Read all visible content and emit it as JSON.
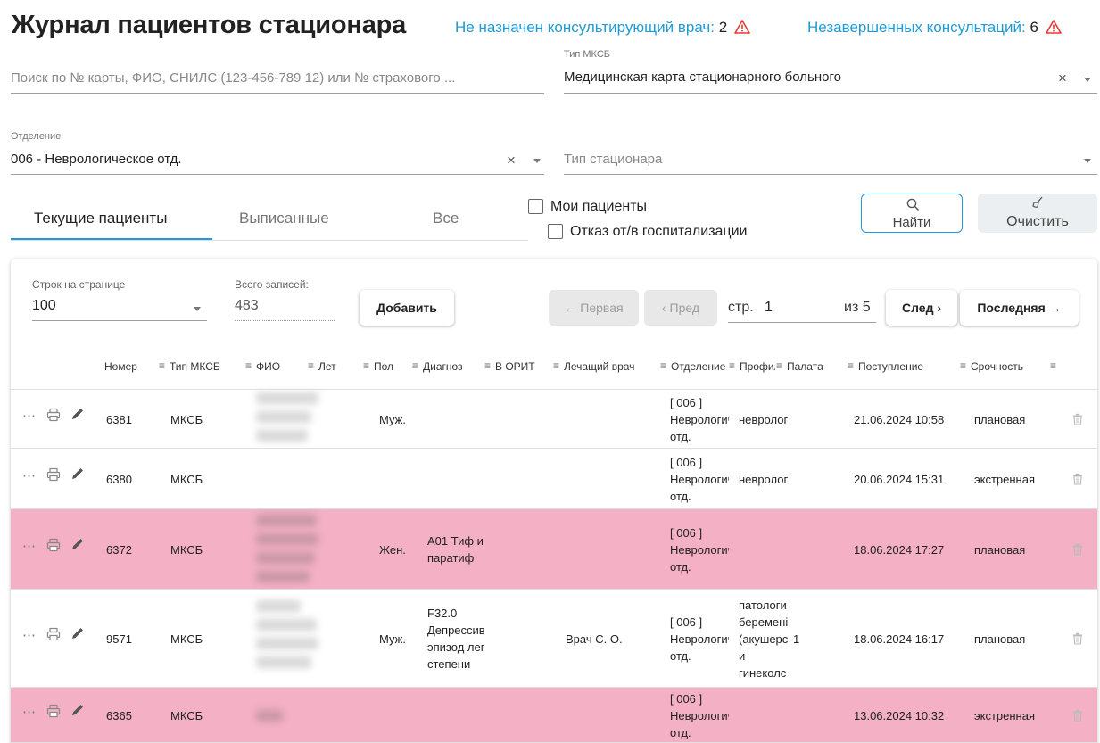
{
  "page": {
    "title": "Журнал пациентов стационара",
    "warn1_label": "Не назначен консультирующий врач:",
    "warn1_count": "2",
    "warn2_label": "Незавершенных консультаций:",
    "warn2_count": "6"
  },
  "filters": {
    "search_placeholder": "Поиск по № карты, ФИО, СНИЛС (123-456-789 12) или № страхового ...",
    "mksb_type_label": "Тип МКСБ",
    "mksb_type_value": "Медицинская карта стационарного больного",
    "department_label": "Отделение",
    "department_value": "006 - Неврологическое отд.",
    "hospital_type_placeholder": "Тип стационара",
    "clear_symbol": "×"
  },
  "tabs": [
    "Текущие пациенты",
    "Выписанные",
    "Все"
  ],
  "checkboxes": {
    "my_patients": "Мои пациенты",
    "refusal": "Отказ от/в госпитализации"
  },
  "buttons": {
    "find": "Найти",
    "clear": "Очистить",
    "add": "Добавить"
  },
  "pagination": {
    "rows_label": "Строк на странице",
    "rows_value": "100",
    "total_label": "Всего записей:",
    "total_value": "483",
    "first": "← Первая",
    "prev": "‹ Пред",
    "page_label": "стр.",
    "page_value": "1",
    "of_label": "из 5",
    "next": "След ›",
    "last": "Последняя →"
  },
  "columns": [
    "Номер",
    "Тип МКСБ",
    "ФИО",
    "Лет",
    "Пол",
    "Диагноз",
    "В ОРИТ",
    "Лечащий врач",
    "Отделение",
    "Профиль",
    "Палата",
    "Поступление",
    "Срочность"
  ],
  "rows": [
    {
      "number": "6381",
      "type": "МКСБ",
      "sex": "Муж.",
      "diagnosis": [],
      "doctor": "",
      "department": [
        "[ 006 ]",
        "Неврологич",
        "отд."
      ],
      "profile": [
        "невролог"
      ],
      "admission": "21.06.2024 10:58",
      "urgency": "плановая",
      "highlight": false
    },
    {
      "number": "6380",
      "type": "МКСБ",
      "sex": "",
      "diagnosis": [],
      "doctor": "",
      "department": [
        "[ 006 ]",
        "Неврологич",
        "отд."
      ],
      "profile": [
        "невролог"
      ],
      "admission": "20.06.2024 15:31",
      "urgency": "экстренная",
      "highlight": false
    },
    {
      "number": "6372",
      "type": "МКСБ",
      "sex": "Жен.",
      "diagnosis": [
        "А01 Тиф и",
        "паратиф"
      ],
      "doctor": "",
      "department": [
        "[ 006 ]",
        "Неврологич",
        "отд."
      ],
      "profile": [],
      "admission": "18.06.2024 17:27",
      "urgency": "плановая",
      "highlight": true
    },
    {
      "number": "9571",
      "type": "МКСБ",
      "sex": "Муж.",
      "diagnosis": [
        "F32.0",
        "Депрессивн",
        "эпизод легк",
        "степени"
      ],
      "doctor": "Врач С. О.",
      "department": [
        "[ 006 ]",
        "Неврологич",
        "отд."
      ],
      "profile": [
        "патологи",
        "беремені",
        "(акушерс",
        "и",
        "гинеколс"
      ],
      "ward": "1",
      "admission": "18.06.2024 16:17",
      "urgency": "плановая",
      "highlight": false
    },
    {
      "number": "6365",
      "type": "МКСБ",
      "sex": "",
      "diagnosis": [],
      "doctor": "",
      "department": [
        "[ 006 ]",
        "Неврологич",
        "отд."
      ],
      "profile": [],
      "admission": "13.06.2024 10:32",
      "urgency": "экстренная",
      "highlight": true
    }
  ],
  "colors": {
    "accent": "#1e9bd7",
    "warning": "#e53935",
    "highlight_row": "#f4b0c4"
  }
}
